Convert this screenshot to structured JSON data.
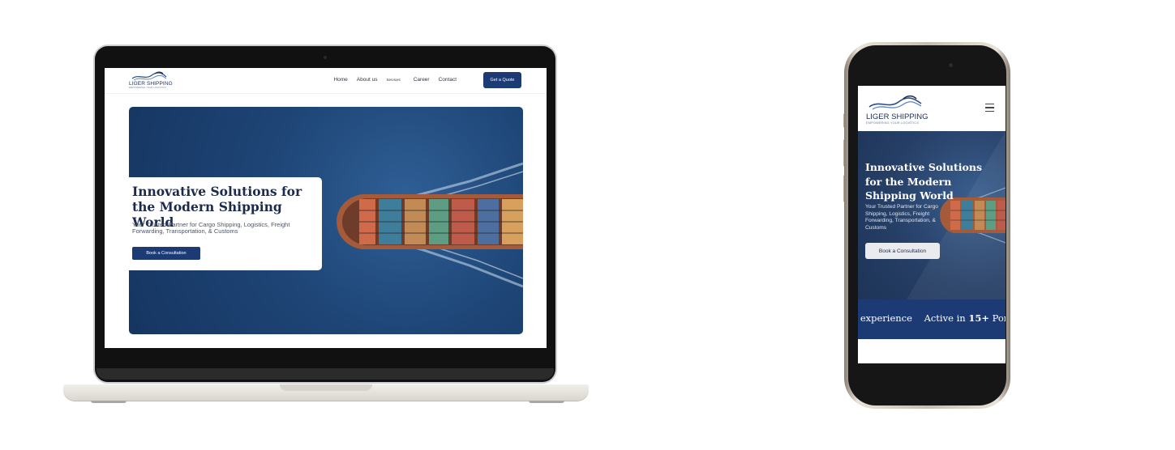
{
  "brand": {
    "name": "LIGER SHIPPING",
    "tagline": "EMPOWERING YOUR LOGISTICS",
    "primary_color": "#1c3a73",
    "dark_text_color": "#1b2a4d"
  },
  "desktop": {
    "nav": {
      "items": [
        "Home",
        "About us",
        "Services",
        "Career",
        "Contact"
      ],
      "cta": "Get a Quote"
    },
    "hero": {
      "title": "Innovative Solutions for the Modern Shipping World",
      "subtitle": "Your Trusted Partner for Cargo Shipping, Logistics, Freight Forwarding, Transportation, & Customs",
      "button": "Book a Consultation"
    }
  },
  "mobile": {
    "menu_icon": "hamburger-menu-icon",
    "hero": {
      "title": "Innovative Solutions for the Modern Shipping World",
      "subtitle": "Your Trusted Partner for Cargo Shipping, Logistics, Freight Forwarding, Transportation, & Customs",
      "button": "Book a Consultation"
    },
    "stats_band": {
      "item1": "of experience",
      "item2_prefix": "Active in",
      "item2_value": "15+",
      "item2_suffix": "Ports"
    }
  }
}
